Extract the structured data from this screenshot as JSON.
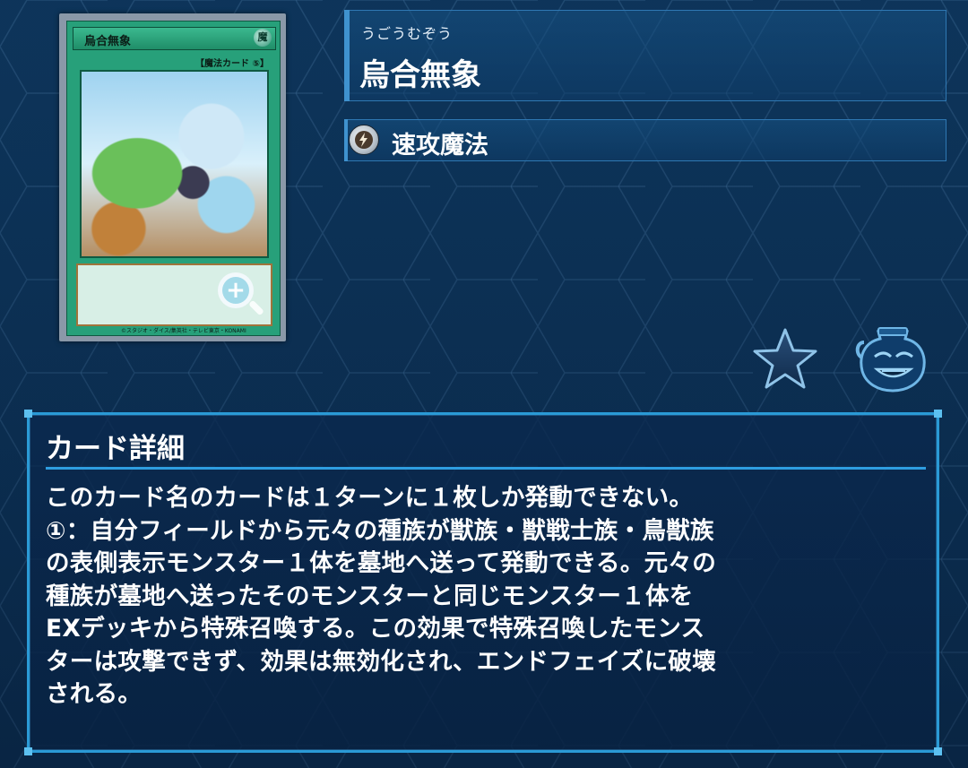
{
  "card_image": {
    "name": "烏合無象",
    "name_ruby": "うごうむぞう",
    "attribute": "魔",
    "type_line": "【魔法カード ⑤】",
    "copyright": "©スタジオ・ダイス/集英社・テレビ東京・KONAMI"
  },
  "header": {
    "ruby": "うごうむぞう",
    "name": "烏合無象"
  },
  "type": {
    "icon": "quick-play-spell-icon",
    "label": "速攻魔法"
  },
  "actions": {
    "favorite_icon": "star-icon",
    "deck_icon": "pot-of-greed-icon"
  },
  "detail": {
    "title": "カード詳細",
    "text": "このカード名のカードは１ターンに１枚しか発動できない。\n①：自分フィールドから元々の種族が獣族・獣戦士族・鳥獣族\nの表側表示モンスター１体を墓地へ送って発動できる。元々の\n種族が墓地へ送ったそのモンスターと同じモンスター１体を\nEXデッキから特殊召喚する。この効果で特殊召喚したモンス\nターは攻撃できず、効果は無効化され、エンドフェイズに破壊\nされる。"
  },
  "colors": {
    "background": "#0d3358",
    "panel_border": "#2a9ad6",
    "accent": "#3f92cf",
    "card_green": "#27a07a"
  }
}
